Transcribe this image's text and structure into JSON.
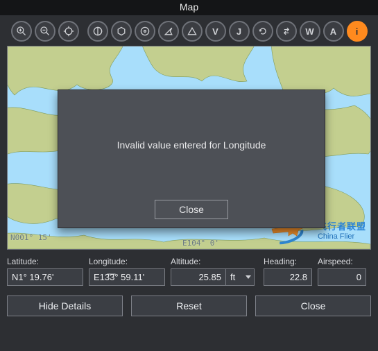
{
  "title": "Map",
  "toolbar": {
    "items": [
      {
        "name": "zoom-in-icon",
        "kind": "svg",
        "svg": "magnify-plus"
      },
      {
        "name": "zoom-out-icon",
        "kind": "svg",
        "svg": "magnify-minus"
      },
      {
        "name": "center-icon",
        "kind": "svg",
        "svg": "crosshair"
      },
      {
        "name": "sep"
      },
      {
        "name": "contrast-icon",
        "kind": "svg",
        "svg": "contrast"
      },
      {
        "name": "hex-icon",
        "kind": "svg",
        "svg": "hexagon"
      },
      {
        "name": "target-icon",
        "kind": "svg",
        "svg": "dot-target"
      },
      {
        "name": "arrow-icon",
        "kind": "svg",
        "svg": "compass-arrow"
      },
      {
        "name": "triangle-icon",
        "kind": "svg",
        "svg": "triangle"
      },
      {
        "name": "letter-v-icon",
        "kind": "letter",
        "letter": "V"
      },
      {
        "name": "letter-j-icon",
        "kind": "letter",
        "letter": "J"
      },
      {
        "name": "refresh-icon",
        "kind": "svg",
        "svg": "refresh"
      },
      {
        "name": "reverse-icon",
        "kind": "svg",
        "svg": "reverse"
      },
      {
        "name": "letter-w-icon",
        "kind": "letter",
        "letter": "W"
      },
      {
        "name": "letter-a-icon",
        "kind": "letter",
        "letter": "A"
      },
      {
        "name": "info-icon",
        "kind": "letter",
        "letter": "i",
        "accent": true
      }
    ]
  },
  "map": {
    "label1": "N001° 15'",
    "label2": "E104° 0'"
  },
  "modal": {
    "message": "Invalid value entered for Longitude",
    "close_label": "Close"
  },
  "form": {
    "latitude": {
      "label": "Latitude:",
      "value": "N1° 19.76'"
    },
    "longitude": {
      "label": "Longitude:",
      "value": "E13͞3° 59.11'"
    },
    "altitude": {
      "label": "Altitude:",
      "value": "25.85",
      "unit": "ft"
    },
    "heading": {
      "label": "Heading:",
      "value": "22.8"
    },
    "airspeed": {
      "label": "Airspeed:",
      "value": "0"
    }
  },
  "buttons": {
    "hide_details": "Hide Details",
    "reset": "Reset",
    "close": "Close"
  },
  "watermark": {
    "top": "飞行者联盟",
    "bottom": "China Flier"
  }
}
